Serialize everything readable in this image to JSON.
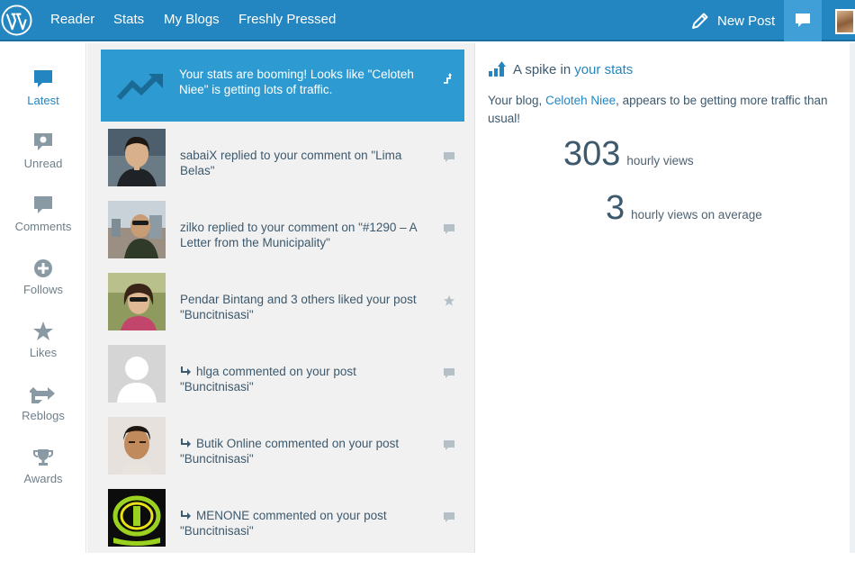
{
  "topbar": {
    "logo": "wordpress-logo",
    "nav": [
      "Reader",
      "Stats",
      "My Blogs",
      "Freshly Pressed"
    ],
    "new_post_label": "New Post",
    "accent": "#2386c0"
  },
  "sidebar": {
    "items": [
      {
        "label": "Latest",
        "icon": "speech-bubble-icon",
        "active": true
      },
      {
        "label": "Unread",
        "icon": "unread-icon",
        "active": false
      },
      {
        "label": "Comments",
        "icon": "comment-icon",
        "active": false
      },
      {
        "label": "Follows",
        "icon": "plus-circle-icon",
        "active": false
      },
      {
        "label": "Likes",
        "icon": "star-icon",
        "active": false
      },
      {
        "label": "Reblogs",
        "icon": "reblog-icon",
        "active": false
      },
      {
        "label": "Awards",
        "icon": "trophy-icon",
        "active": false
      }
    ]
  },
  "notes": [
    {
      "text": "Your stats are booming! Looks like \"Celoteh Niee\" is getting lots of traffic.",
      "featured": true,
      "icon": "trend-up-icon"
    },
    {
      "text": "sabaiX replied to your comment on \"Lima Belas\"",
      "icon": "comment-icon"
    },
    {
      "text": "zilko replied to your comment on \"#1290 – A Letter from the Municipality\"",
      "icon": "comment-icon"
    },
    {
      "text": "Pendar Bintang and 3 others liked your post \"Buncitnisasi\"",
      "icon": "star-icon"
    },
    {
      "text": "hlga commented on your post \"Buncitnisasi\"",
      "icon": "comment-icon",
      "reply": true
    },
    {
      "text": "Butik Online commented on your post \"Buncitnisasi\"",
      "icon": "comment-icon",
      "reply": true
    },
    {
      "text": "MENONE commented on your post \"Buncitnisasi\"",
      "icon": "comment-icon",
      "reply": true
    }
  ],
  "detail": {
    "title_prefix": "A spike in",
    "title_link": "your stats",
    "body_pre": "Your blog,",
    "body_link": "Celoteh Niee",
    "body_post": ", appears to be getting more traffic than usual!",
    "hourly_views": "303",
    "hourly_views_label": "hourly views",
    "average_views": "3",
    "average_views_label": "hourly views on average"
  }
}
